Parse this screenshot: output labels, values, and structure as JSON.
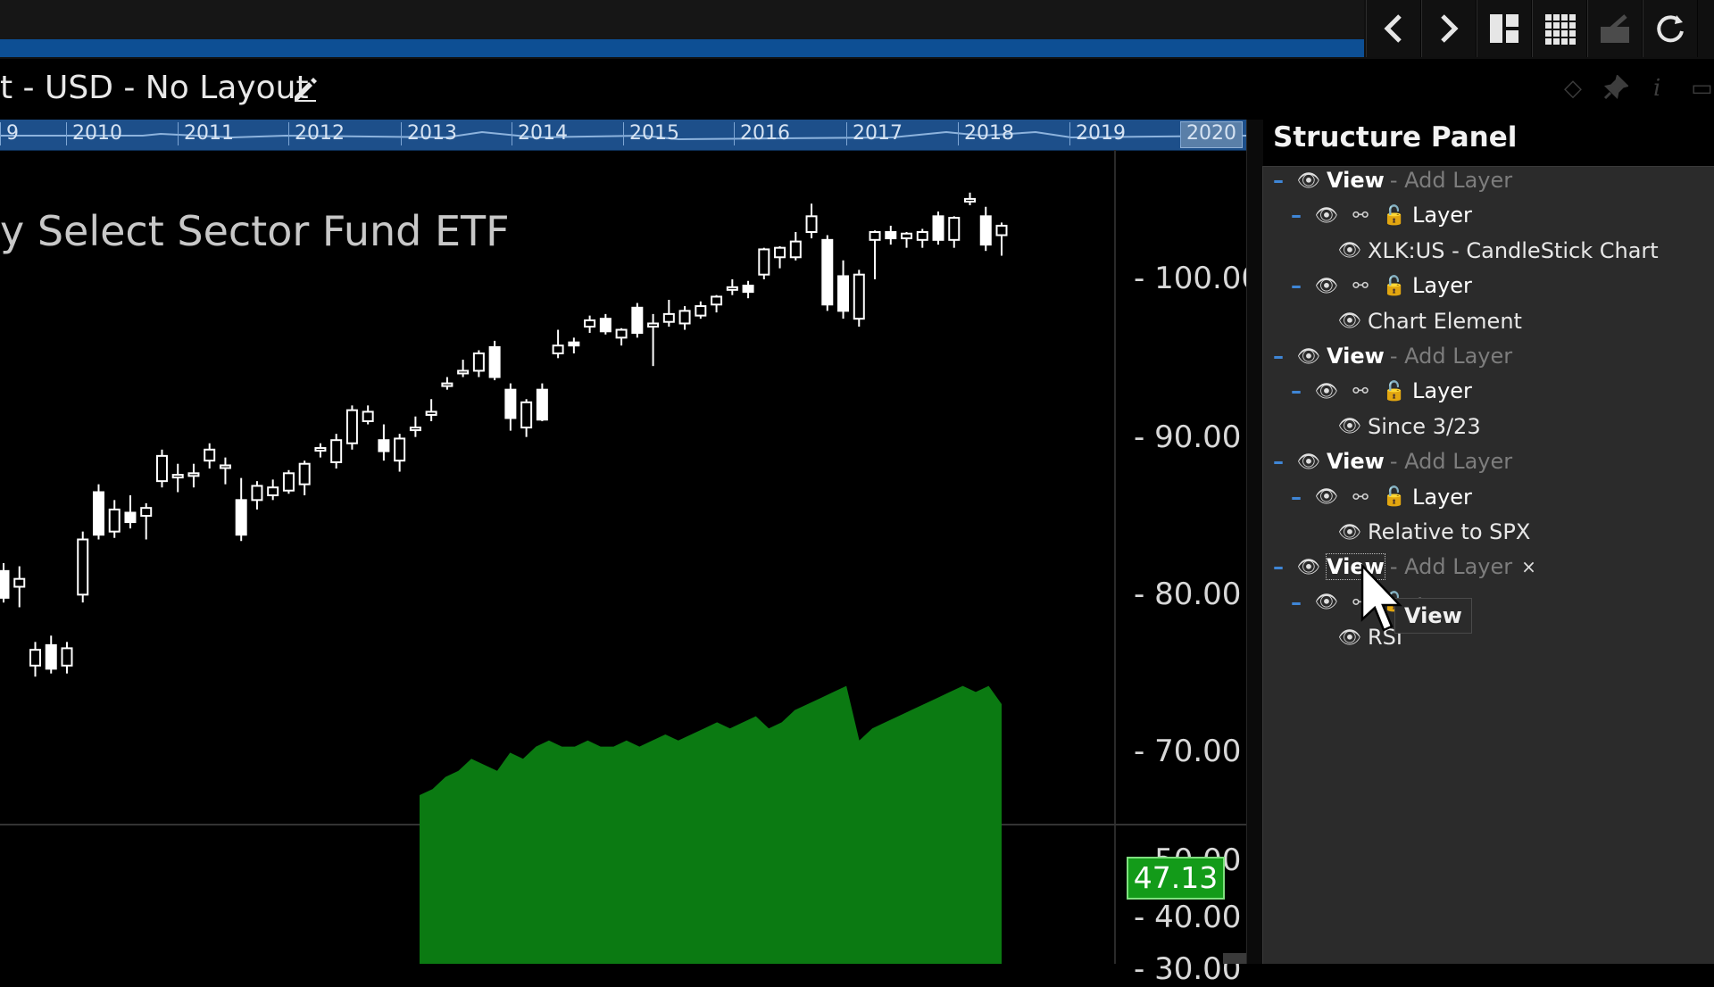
{
  "toolbar": {
    "back_icon": "chevron-left-icon",
    "forward_icon": "chevron-right-icon",
    "layout_icon": "panel-layout-icon",
    "grid_icon": "grid-icon",
    "export_icon": "export-icon",
    "refresh_icon": "refresh-icon"
  },
  "header": {
    "title": "t - USD - No Layout",
    "edit_icon": "pencil-icon"
  },
  "timeline": {
    "years": [
      "9",
      "2010",
      "2011",
      "2012",
      "2013",
      "2014",
      "2015",
      "2016",
      "2017",
      "2018",
      "2019",
      "2020"
    ],
    "selected": "2020"
  },
  "chart": {
    "title_fragment": "y Select Sector Fund ETF",
    "price_labels": [
      "100.00",
      "90.00",
      "80.00",
      "70.00"
    ],
    "rsi_labels": [
      "50.00",
      "40.00",
      "30.00"
    ],
    "rsi_value": "47.13"
  },
  "chart_data": {
    "type": "candlestick",
    "ylim": [
      60,
      107
    ],
    "candles": [
      {
        "o": 81.5,
        "h": 82.0,
        "l": 79.5,
        "c": 79.8
      },
      {
        "o": 80.5,
        "h": 81.8,
        "l": 79.2,
        "c": 81.0
      },
      {
        "o": 75.5,
        "h": 77.0,
        "l": 74.8,
        "c": 76.5
      },
      {
        "o": 76.8,
        "h": 77.4,
        "l": 75.0,
        "c": 75.3
      },
      {
        "o": 75.5,
        "h": 77.0,
        "l": 75.0,
        "c": 76.6
      },
      {
        "o": 80.0,
        "h": 84.0,
        "l": 79.5,
        "c": 83.5
      },
      {
        "o": 86.5,
        "h": 87.0,
        "l": 83.5,
        "c": 83.8
      },
      {
        "o": 84.0,
        "h": 86.0,
        "l": 83.6,
        "c": 85.4
      },
      {
        "o": 85.2,
        "h": 86.3,
        "l": 84.2,
        "c": 84.6
      },
      {
        "o": 85.0,
        "h": 85.8,
        "l": 83.5,
        "c": 85.5
      },
      {
        "o": 87.2,
        "h": 89.2,
        "l": 86.8,
        "c": 88.8
      },
      {
        "o": 87.6,
        "h": 88.3,
        "l": 86.5,
        "c": 87.6
      },
      {
        "o": 87.7,
        "h": 88.3,
        "l": 86.8,
        "c": 87.7
      },
      {
        "o": 88.5,
        "h": 89.6,
        "l": 88.0,
        "c": 89.2
      },
      {
        "o": 88.2,
        "h": 88.7,
        "l": 87.0,
        "c": 88.2
      },
      {
        "o": 86.0,
        "h": 87.4,
        "l": 83.4,
        "c": 83.8
      },
      {
        "o": 86.0,
        "h": 87.2,
        "l": 85.4,
        "c": 86.9
      },
      {
        "o": 86.3,
        "h": 87.3,
        "l": 86.0,
        "c": 86.8
      },
      {
        "o": 86.6,
        "h": 87.9,
        "l": 86.4,
        "c": 87.7
      },
      {
        "o": 87.0,
        "h": 88.5,
        "l": 86.3,
        "c": 88.3
      },
      {
        "o": 89.3,
        "h": 89.6,
        "l": 88.7,
        "c": 89.3
      },
      {
        "o": 88.4,
        "h": 90.2,
        "l": 88.0,
        "c": 89.8
      },
      {
        "o": 89.6,
        "h": 92.0,
        "l": 89.2,
        "c": 91.7
      },
      {
        "o": 91.0,
        "h": 92.0,
        "l": 90.8,
        "c": 91.6
      },
      {
        "o": 89.8,
        "h": 90.8,
        "l": 88.5,
        "c": 89.1
      },
      {
        "o": 88.5,
        "h": 90.2,
        "l": 87.8,
        "c": 89.9
      },
      {
        "o": 90.6,
        "h": 91.3,
        "l": 90.0,
        "c": 90.6
      },
      {
        "o": 91.4,
        "h": 92.4,
        "l": 91.0,
        "c": 91.6
      },
      {
        "o": 93.4,
        "h": 93.8,
        "l": 93.0,
        "c": 93.4
      },
      {
        "o": 94.2,
        "h": 94.9,
        "l": 93.8,
        "c": 94.2
      },
      {
        "o": 94.2,
        "h": 95.5,
        "l": 93.8,
        "c": 95.3
      },
      {
        "o": 95.7,
        "h": 96.1,
        "l": 93.6,
        "c": 93.8
      },
      {
        "o": 93.0,
        "h": 93.4,
        "l": 90.4,
        "c": 91.2
      },
      {
        "o": 90.6,
        "h": 92.4,
        "l": 90.0,
        "c": 92.2
      },
      {
        "o": 93.0,
        "h": 93.4,
        "l": 91.0,
        "c": 91.1
      },
      {
        "o": 95.3,
        "h": 96.8,
        "l": 95.0,
        "c": 95.8
      },
      {
        "o": 96.0,
        "h": 96.3,
        "l": 95.3,
        "c": 95.8
      },
      {
        "o": 97.0,
        "h": 97.7,
        "l": 96.6,
        "c": 97.4
      },
      {
        "o": 97.5,
        "h": 97.8,
        "l": 96.5,
        "c": 96.7
      },
      {
        "o": 96.3,
        "h": 96.9,
        "l": 95.8,
        "c": 96.8
      },
      {
        "o": 98.2,
        "h": 98.5,
        "l": 96.3,
        "c": 96.6
      },
      {
        "o": 97.0,
        "h": 97.8,
        "l": 94.5,
        "c": 97.2
      },
      {
        "o": 97.3,
        "h": 98.7,
        "l": 97.0,
        "c": 97.8
      },
      {
        "o": 97.2,
        "h": 98.3,
        "l": 96.8,
        "c": 98.0
      },
      {
        "o": 97.7,
        "h": 98.6,
        "l": 97.5,
        "c": 98.3
      },
      {
        "o": 98.4,
        "h": 99.0,
        "l": 97.9,
        "c": 98.9
      },
      {
        "o": 99.5,
        "h": 100.0,
        "l": 99.0,
        "c": 99.5
      },
      {
        "o": 99.6,
        "h": 99.9,
        "l": 98.8,
        "c": 99.2
      },
      {
        "o": 100.3,
        "h": 102.0,
        "l": 100.0,
        "c": 101.9
      },
      {
        "o": 101.4,
        "h": 102.1,
        "l": 100.7,
        "c": 102.0
      },
      {
        "o": 101.4,
        "h": 103.0,
        "l": 101.2,
        "c": 102.4
      },
      {
        "o": 103.0,
        "h": 104.8,
        "l": 102.6,
        "c": 104.0
      },
      {
        "o": 102.5,
        "h": 102.8,
        "l": 98.0,
        "c": 98.4
      },
      {
        "o": 100.2,
        "h": 101.2,
        "l": 97.5,
        "c": 98.0
      },
      {
        "o": 97.5,
        "h": 100.6,
        "l": 97.0,
        "c": 100.3
      },
      {
        "o": 102.5,
        "h": 103.1,
        "l": 100.0,
        "c": 103.0
      },
      {
        "o": 103.0,
        "h": 103.4,
        "l": 102.2,
        "c": 102.6
      },
      {
        "o": 102.6,
        "h": 103.0,
        "l": 102.0,
        "c": 102.9
      },
      {
        "o": 102.5,
        "h": 103.2,
        "l": 102.0,
        "c": 103.0
      },
      {
        "o": 104.0,
        "h": 104.3,
        "l": 102.2,
        "c": 102.5
      },
      {
        "o": 102.5,
        "h": 104.0,
        "l": 102.0,
        "c": 103.9
      },
      {
        "o": 105.1,
        "h": 105.5,
        "l": 104.7,
        "c": 105.1
      },
      {
        "o": 104.0,
        "h": 104.6,
        "l": 101.8,
        "c": 102.2
      },
      {
        "o": 102.8,
        "h": 103.6,
        "l": 101.5,
        "c": 103.4
      }
    ],
    "rsi": [
      60,
      61,
      63,
      64,
      66,
      65,
      64,
      67,
      66,
      68,
      69,
      68,
      68,
      69,
      68,
      68,
      69,
      68,
      69,
      70,
      69,
      70,
      71,
      72,
      71,
      72,
      73,
      71,
      72,
      74,
      75,
      76,
      77,
      78,
      69,
      71,
      72,
      73,
      74,
      75,
      76,
      77,
      78,
      77,
      78,
      75
    ]
  },
  "panel": {
    "title": "Structure Panel",
    "rows": [
      {
        "kind": "view",
        "label": "View",
        "suffix": "- Add Layer"
      },
      {
        "kind": "layer",
        "label": "Layer"
      },
      {
        "kind": "item",
        "label": "XLK:US - CandleStick Chart"
      },
      {
        "kind": "layer",
        "label": "Layer"
      },
      {
        "kind": "item",
        "label": "Chart Element"
      },
      {
        "kind": "view",
        "label": "View",
        "suffix": "- Add Layer"
      },
      {
        "kind": "layer",
        "label": "Layer"
      },
      {
        "kind": "item",
        "label": "Since 3/23"
      },
      {
        "kind": "view",
        "label": "View",
        "suffix": "- Add Layer"
      },
      {
        "kind": "layer",
        "label": "Layer"
      },
      {
        "kind": "item",
        "label": "Relative to SPX"
      },
      {
        "kind": "view",
        "label": "View",
        "suffix": "- Add Layer",
        "close": "×"
      },
      {
        "kind": "layer",
        "label": "r"
      },
      {
        "kind": "item",
        "label": "RSI"
      }
    ],
    "tooltip": "View"
  },
  "colors": {
    "accent_blue": "#0d4f94",
    "rsi_green": "#0b7a12",
    "badge_green": "#139b19"
  }
}
